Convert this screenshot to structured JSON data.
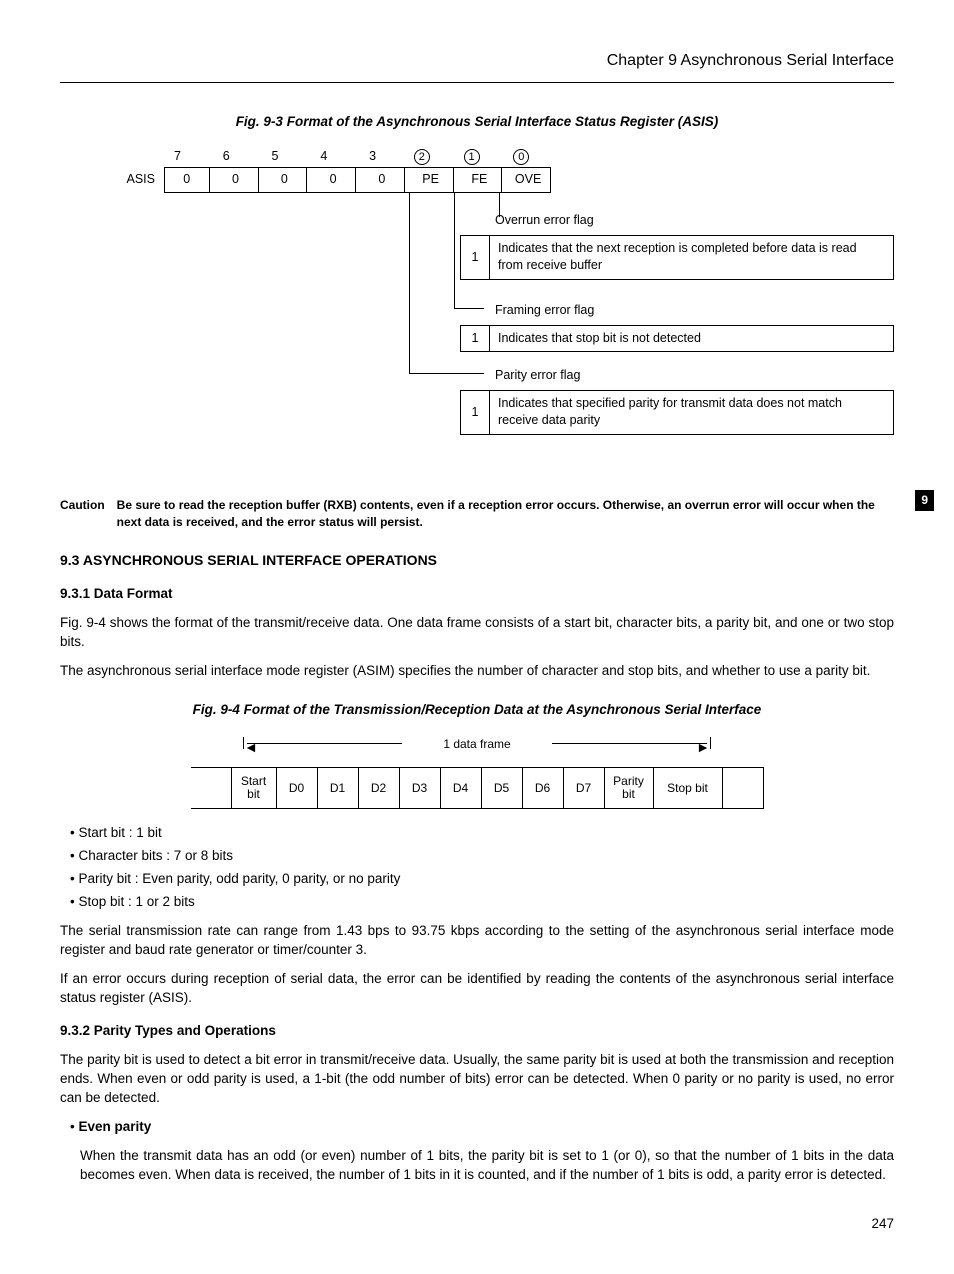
{
  "header": "Chapter 9   Asynchronous Serial Interface",
  "fig93": {
    "title": "Fig. 9-3  Format of the Asynchronous Serial Interface Status Register (ASIS)",
    "bits": [
      "7",
      "6",
      "5",
      "4",
      "3",
      "2",
      "1",
      "0"
    ],
    "circled": [
      5,
      6,
      7
    ],
    "regname": "ASIS",
    "cells": [
      "0",
      "0",
      "0",
      "0",
      "0",
      "PE",
      "FE",
      "OVE"
    ],
    "flags": {
      "b0": {
        "label": "Overrun error flag",
        "val": "1",
        "desc": "Indicates that the next reception is completed before data is read from receive buffer"
      },
      "b1": {
        "label": "Framing error flag",
        "val": "1",
        "desc": "Indicates that stop bit is not detected"
      },
      "b2": {
        "label": "Parity error flag",
        "val": "1",
        "desc": "Indicates that specified parity for transmit data does not match receive data parity"
      }
    }
  },
  "caution": {
    "label": "Caution",
    "text": "Be sure to read the reception buffer (RXB) contents, even if a reception error occurs.  Otherwise, an overrun error will occur when the next data is received, and the error status will persist."
  },
  "s93": "9.3  ASYNCHRONOUS SERIAL INTERFACE OPERATIONS",
  "s931": "9.3.1  Data Format",
  "p1": "Fig. 9-4 shows the format of the transmit/receive data.  One data frame consists of a start bit, character bits, a parity bit, and one or two stop bits.",
  "p2": "The asynchronous serial interface mode register (ASIM) specifies the number of character and stop bits, and whether to use a parity bit.",
  "fig94": {
    "title": "Fig. 9-4  Format of the Transmission/Reception Data at the Asynchronous Serial Interface",
    "frame_label": "1 data frame",
    "cells": [
      "Start bit",
      "D0",
      "D1",
      "D2",
      "D3",
      "D4",
      "D5",
      "D6",
      "D7",
      "Parity bit",
      "Stop bit"
    ]
  },
  "list1": [
    "Start bit :  1 bit",
    "Character bits :  7 or 8 bits",
    "Parity bit :  Even parity, odd parity, 0 parity, or no parity",
    "Stop bit :  1 or 2 bits"
  ],
  "p3": "The serial transmission rate can range from 1.43 bps to 93.75 kbps according to the setting of the asynchronous serial interface mode register and baud rate generator or timer/counter 3.",
  "p4": "If an error occurs during reception of serial data, the error can be identified by reading the contents of the asynchronous serial interface status register (ASIS).",
  "s932": "9.3.2  Parity Types and Operations",
  "p5": "The parity bit is used to detect a bit error in transmit/receive data.  Usually, the same parity bit is used at both the transmission and reception ends.  When even or odd parity is used, a 1-bit (the odd number of bits) error can be detected.  When 0 parity or no parity is used, no error can be detected.",
  "even_label": "Even parity",
  "p6": "When the transmit data has an odd (or even) number of 1 bits, the parity bit is set to 1 (or 0), so that the number of 1 bits in the data becomes even.  When data is received, the number of 1 bits in it is counted, and if the number of 1 bits is odd, a parity error is detected.",
  "side_tab": "9",
  "page": "247"
}
